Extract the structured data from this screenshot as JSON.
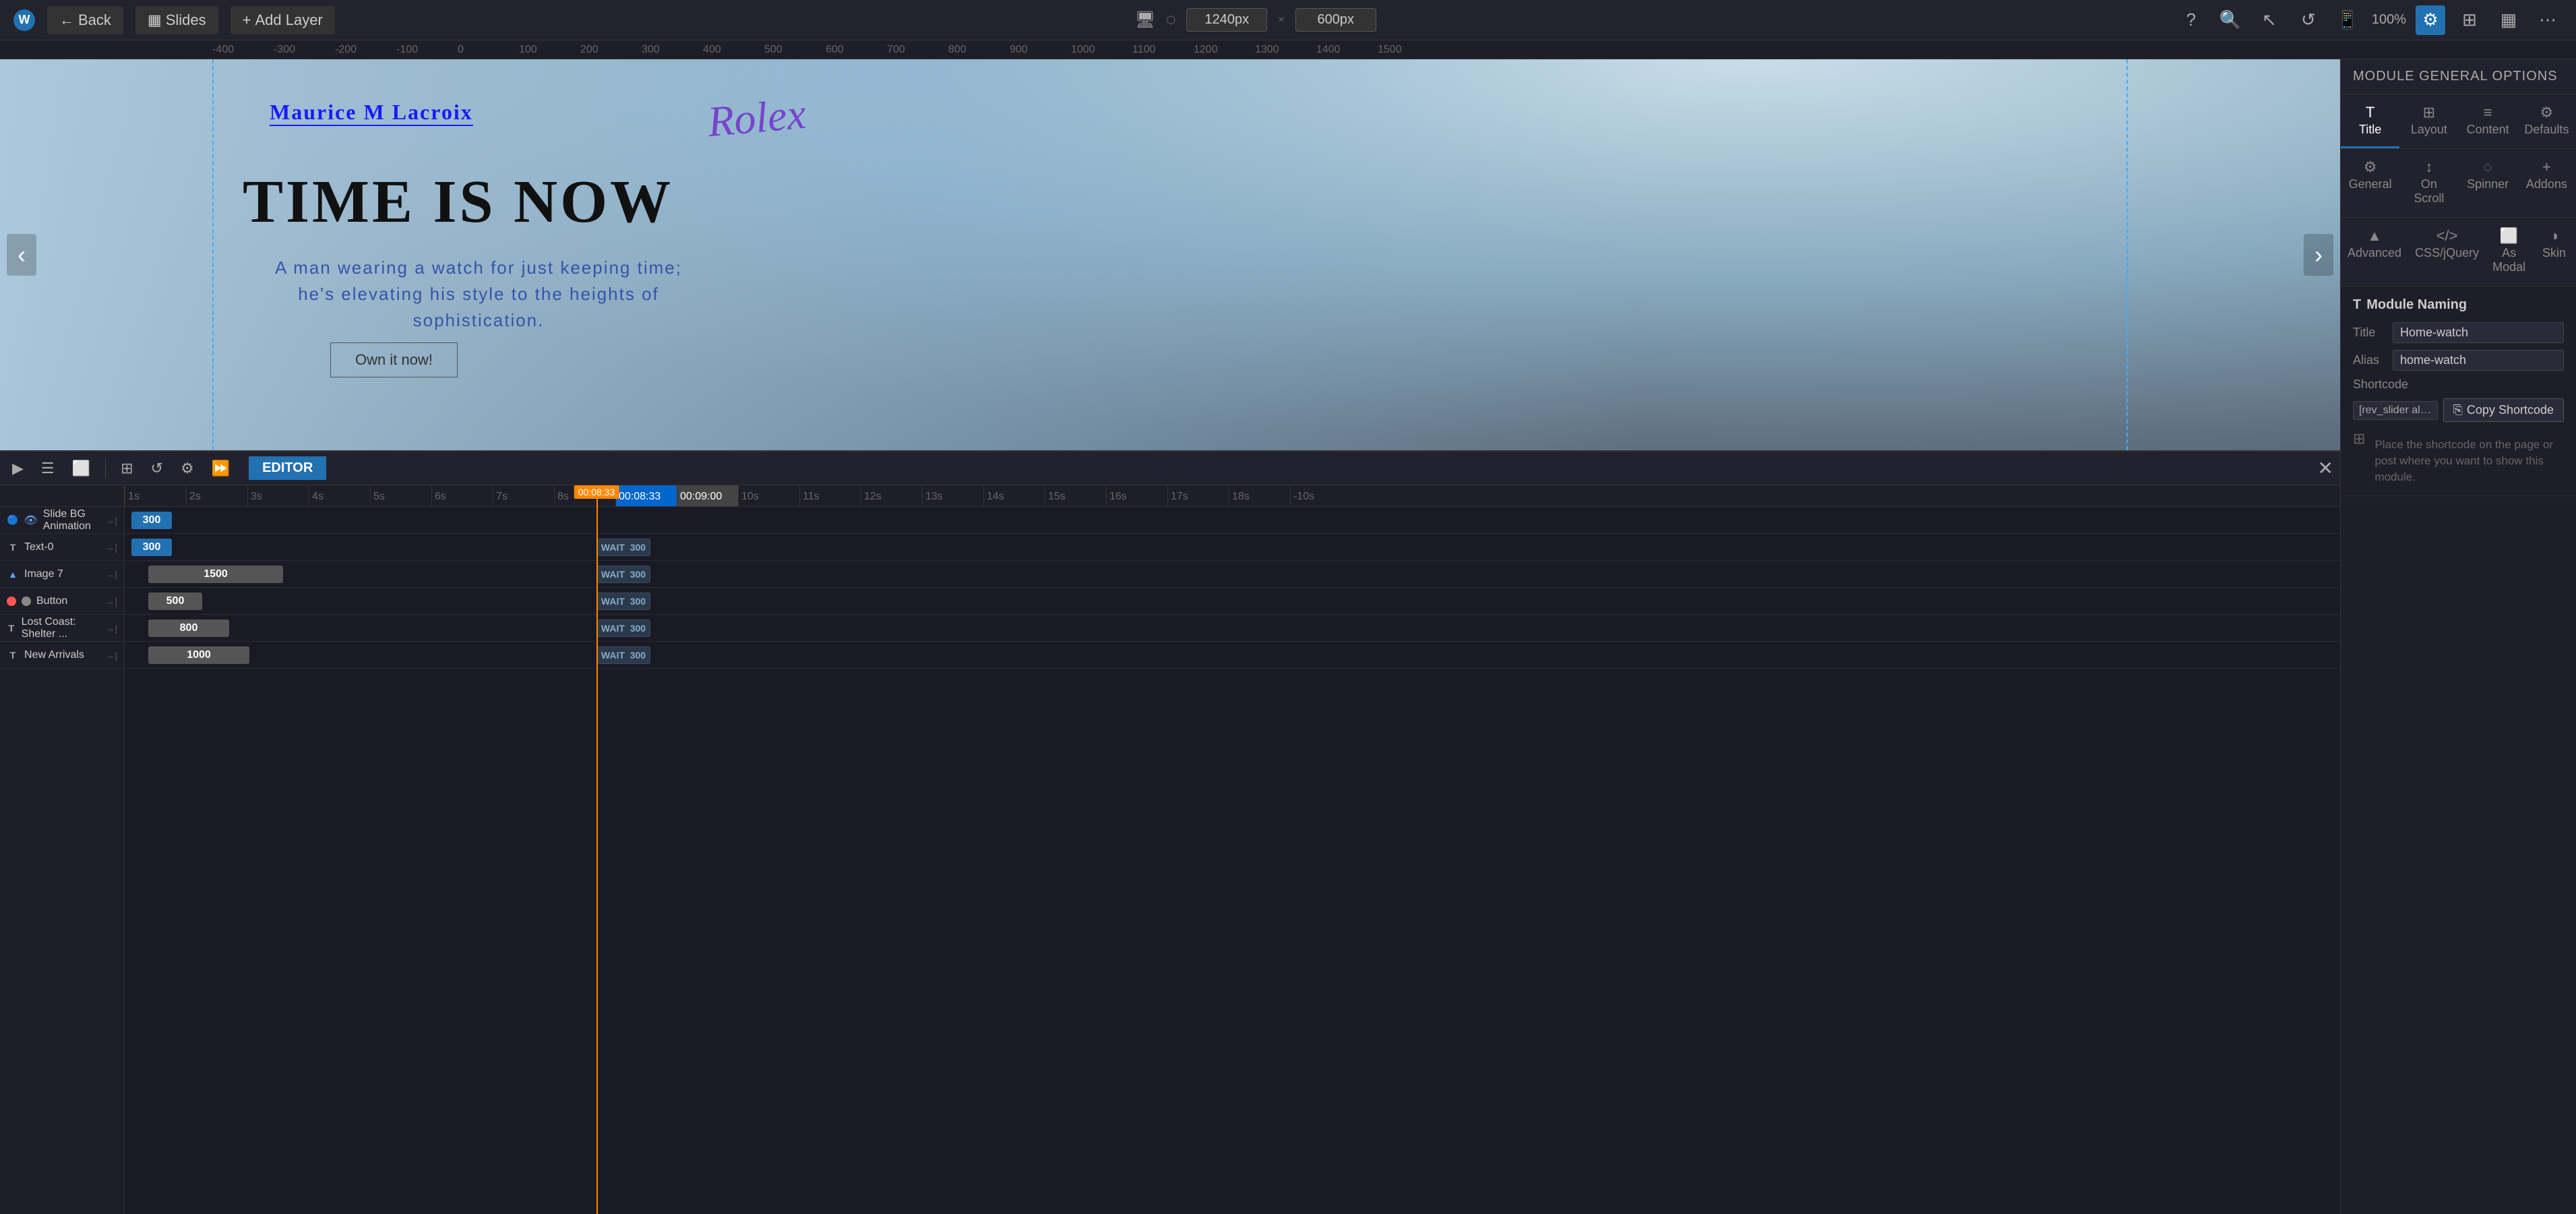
{
  "topbar": {
    "back_label": "Back",
    "slides_label": "Slides",
    "add_layer_label": "Add Layer",
    "width_value": "1240px",
    "height_value": "600px",
    "zoom_label": "100%"
  },
  "ruler": {
    "marks": [
      "-400",
      "-300",
      "-200",
      "-100",
      "0",
      "100",
      "200",
      "300",
      "400",
      "500",
      "600",
      "700",
      "800",
      "900",
      "1000",
      "1100",
      "1200",
      "1300",
      "1400",
      "1500"
    ]
  },
  "slide": {
    "brand_ml": "Maurice M Lacroix",
    "brand_rolex": "Rolex",
    "headline": "TIME IS NOW",
    "subtext": "A man wearing a watch for just keeping time;\nhe's elevating his style to the heights of sophistication.",
    "cta_label": "Own it now!"
  },
  "timeline": {
    "editor_label": "EDITOR",
    "time_marks": [
      "1s",
      "2s",
      "3s",
      "4s",
      "5s",
      "6s",
      "7s",
      "8s",
      "00:08:33",
      "00:09:00",
      "10s",
      "11s",
      "12s",
      "13s",
      "14s",
      "15s",
      "16s",
      "17s",
      "18s",
      "-10s"
    ],
    "current_time": "00:08:33",
    "next_time": "00:09:00",
    "tracks": [
      {
        "id": "slide-bg",
        "icon": "☰",
        "icon_type": "menu",
        "color": "#2271b1",
        "label": "Slide BG Animation",
        "has_eye": true,
        "block_start": 0,
        "block_val": "300"
      },
      {
        "id": "text-0",
        "icon": "T",
        "icon_type": "t",
        "color": null,
        "label": "Text-0",
        "block_start": 0,
        "block_val": "300"
      },
      {
        "id": "image-7",
        "icon": "▲",
        "icon_type": "img",
        "color": "#5af",
        "label": "Image 7",
        "block_start": 181,
        "block_val": "1500"
      },
      {
        "id": "button",
        "icon": "●",
        "icon_type": "btn",
        "color": "#f55",
        "label": "Button",
        "block_start": 181,
        "block_val": "500"
      },
      {
        "id": "lost-coast",
        "icon": "T",
        "icon_type": "t",
        "color": null,
        "label": "Lost Coast: Shelter ...",
        "block_start": 181,
        "block_val": "800"
      },
      {
        "id": "new-arrivals",
        "icon": "T",
        "icon_type": "t",
        "color": null,
        "label": "New Arrivals",
        "block_start": 181,
        "block_val": "1000"
      }
    ],
    "wait_blocks": [
      {
        "track": 1,
        "label": "WAIT",
        "val": "300"
      },
      {
        "track": 2,
        "label": "WAIT",
        "val": "300"
      },
      {
        "track": 3,
        "label": "WAIT",
        "val": "300"
      },
      {
        "track": 4,
        "label": "WAIT",
        "val": "300"
      },
      {
        "track": 5,
        "label": "WAIT",
        "val": "300"
      }
    ]
  },
  "right_panel": {
    "title": "MODULE GENERAL OPTIONS",
    "tabs_row1": [
      {
        "id": "title",
        "icon": "T",
        "label": "Title",
        "active": true
      },
      {
        "id": "layout",
        "icon": "⊞",
        "label": "Layout",
        "active": false
      },
      {
        "id": "content",
        "icon": "≡",
        "label": "Content",
        "active": false
      },
      {
        "id": "defaults",
        "icon": "⚙",
        "label": "Defaults",
        "active": false
      }
    ],
    "tabs_row2": [
      {
        "id": "general",
        "icon": "⚙",
        "label": "General",
        "active": false
      },
      {
        "id": "on-scroll",
        "icon": "↕",
        "label": "On Scroll",
        "active": false
      },
      {
        "id": "spinner",
        "icon": "◌",
        "label": "Spinner",
        "active": false
      },
      {
        "id": "addons",
        "icon": "+",
        "label": "Addons",
        "active": false
      }
    ],
    "tabs_row3": [
      {
        "id": "advanced",
        "icon": "▲",
        "label": "Advanced",
        "active": false
      },
      {
        "id": "css-jquery",
        "icon": "</>",
        "label": "CSS/jQuery",
        "active": false
      },
      {
        "id": "as-modal",
        "icon": "⬜",
        "label": "As Modal",
        "active": false
      },
      {
        "id": "skin",
        "icon": "◑",
        "label": "Skin",
        "active": false
      }
    ],
    "module_naming": {
      "section_title": "Module Naming",
      "title_label": "Title",
      "title_value": "Home-watch",
      "alias_label": "Alias",
      "alias_value": "home-watch",
      "shortcode_label": "Shortcode",
      "shortcode_value": "[rev_slider alias=\"home-watc",
      "copy_btn_label": "Copy Shortcode",
      "hint_text": "Place the shortcode on the page or post where you want to show this module."
    }
  }
}
